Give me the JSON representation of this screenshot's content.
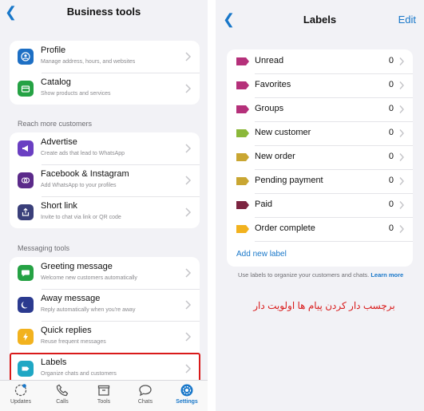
{
  "left": {
    "title": "Business tools",
    "groups": [
      {
        "items": [
          {
            "icon": "profile-icon",
            "title": "Profile",
            "subtitle": "Manage address, hours, and websites"
          },
          {
            "icon": "catalog-icon",
            "title": "Catalog",
            "subtitle": "Show products and services"
          }
        ]
      },
      {
        "header": "Reach more customers",
        "items": [
          {
            "icon": "megaphone-icon",
            "title": "Advertise",
            "subtitle": "Create ads that lead to WhatsApp"
          },
          {
            "icon": "facebook-instagram-icon",
            "title": "Facebook & Instagram",
            "subtitle": "Add WhatsApp to your profiles"
          },
          {
            "icon": "share-icon",
            "title": "Short link",
            "subtitle": "Invite to chat via link or QR code"
          }
        ]
      },
      {
        "header": "Messaging tools",
        "items": [
          {
            "icon": "greeting-message-icon",
            "title": "Greeting message",
            "subtitle": "Welcome new customers automatically"
          },
          {
            "icon": "moon-icon",
            "title": "Away message",
            "subtitle": "Reply automatically when you're away"
          },
          {
            "icon": "lightning-icon",
            "title": "Quick replies",
            "subtitle": "Reuse frequent messages"
          },
          {
            "icon": "label-icon",
            "title": "Labels",
            "subtitle": "Organize chats and customers"
          }
        ]
      }
    ],
    "tabs": [
      {
        "label": "Updates",
        "icon": "updates-icon"
      },
      {
        "label": "Calls",
        "icon": "phone-icon"
      },
      {
        "label": "Tools",
        "icon": "tools-icon"
      },
      {
        "label": "Chats",
        "icon": "chats-icon"
      },
      {
        "label": "Settings",
        "icon": "settings-icon",
        "active": true
      }
    ]
  },
  "right": {
    "title": "Labels",
    "edit": "Edit",
    "labels": [
      {
        "name": "Unread",
        "count": "0",
        "color": "#b5307a"
      },
      {
        "name": "Favorites",
        "count": "0",
        "color": "#b5307a"
      },
      {
        "name": "Groups",
        "count": "0",
        "color": "#b5307a"
      },
      {
        "name": "New customer",
        "count": "0",
        "color": "#8bb83a"
      },
      {
        "name": "New order",
        "count": "0",
        "color": "#c9a632"
      },
      {
        "name": "Pending payment",
        "count": "0",
        "color": "#c9a632"
      },
      {
        "name": "Paid",
        "count": "0",
        "color": "#7c2440"
      },
      {
        "name": "Order complete",
        "count": "0",
        "color": "#f2b21e"
      }
    ],
    "add_label": "Add new label",
    "note_text": "Use labels to organize your customers and chats.",
    "learn_more": "Learn more"
  },
  "annotation": "برچسب دار کردن پیام ها اولویت دار",
  "colors": {
    "accent": "#1877c9",
    "highlight": "#d91a1a"
  }
}
